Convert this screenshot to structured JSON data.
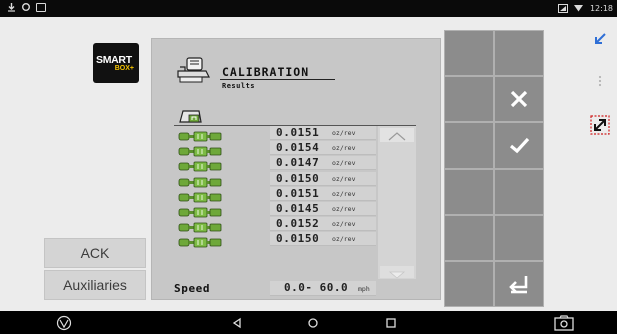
{
  "status_bar": {
    "left_icons": [
      "download-icon",
      "sync-icon",
      "notification-box-icon"
    ],
    "right_icons": [
      "signal-icon",
      "wifi-icon"
    ],
    "time": "12:18"
  },
  "logo": {
    "line1": "SMART",
    "line2": "BOX+"
  },
  "left_buttons": {
    "ack": "ACK",
    "auxiliaries": "Auxiliaries"
  },
  "calibration": {
    "title": "CALIBRATION",
    "subtitle": "Results",
    "unit": "oz/rev",
    "rows": [
      {
        "value": "0.0151",
        "unit": "oz/rev"
      },
      {
        "value": "0.0154",
        "unit": "oz/rev"
      },
      {
        "value": "0.0147",
        "unit": "oz/rev"
      },
      {
        "value": "0.0150",
        "unit": "oz/rev"
      },
      {
        "value": "0.0151",
        "unit": "oz/rev"
      },
      {
        "value": "0.0145",
        "unit": "oz/rev"
      },
      {
        "value": "0.0152",
        "unit": "oz/rev"
      },
      {
        "value": "0.0150",
        "unit": "oz/rev"
      }
    ]
  },
  "speed": {
    "label": "Speed",
    "range": "0.0- 60.0",
    "unit": "mph"
  },
  "grid_buttons": [
    "",
    "",
    "",
    "close-icon",
    "",
    "check-icon",
    "",
    "",
    "",
    "",
    "",
    "return-icon"
  ],
  "tools": [
    "collapse-arrow-icon",
    "more-icon",
    "resize-icon"
  ],
  "nav": [
    "app-logo-icon",
    "back-icon",
    "home-icon",
    "recents-icon",
    "screenshot-icon"
  ],
  "colors": {
    "accent": "#2f6fd6",
    "button_gray": "#8c8c8c",
    "panel": "#c7c7c7",
    "resize_red": "#d02020",
    "logo_yellow": "#f2c200"
  }
}
